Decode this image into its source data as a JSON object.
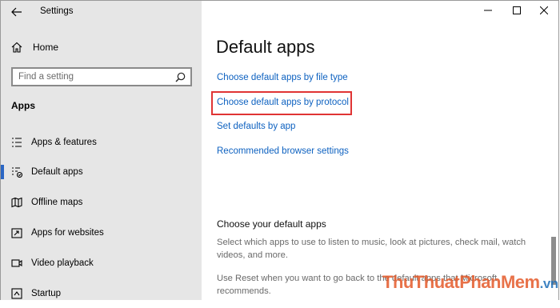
{
  "window": {
    "title": "Settings"
  },
  "sidebar": {
    "home_label": "Home",
    "search_placeholder": "Find a setting",
    "section_title": "Apps",
    "items": [
      {
        "label": "Apps & features",
        "icon": "list-icon",
        "selected": false
      },
      {
        "label": "Default apps",
        "icon": "default-apps-icon",
        "selected": true
      },
      {
        "label": "Offline maps",
        "icon": "map-icon",
        "selected": false
      },
      {
        "label": "Apps for websites",
        "icon": "open-in-window-icon",
        "selected": false
      },
      {
        "label": "Video playback",
        "icon": "video-icon",
        "selected": false
      },
      {
        "label": "Startup",
        "icon": "startup-icon",
        "selected": false
      }
    ]
  },
  "main": {
    "title": "Default apps",
    "links": [
      {
        "label": "Choose default apps by file type",
        "highlighted": false
      },
      {
        "label": "Choose default apps by protocol",
        "highlighted": true
      },
      {
        "label": "Set defaults by app",
        "highlighted": false
      },
      {
        "label": "Recommended browser settings",
        "highlighted": false
      }
    ],
    "section_title": "Choose your default apps",
    "paragraph1": "Select which apps to use to listen to music, look at pictures, check mail, watch videos, and more.",
    "paragraph2": "Use Reset when you want to go back to the default apps that Microsoft recommends."
  },
  "watermark": {
    "text": "ThuThuatPhanMem",
    "domain": ".vn"
  },
  "colors": {
    "link": "#0d61c0",
    "highlight_border": "#e03434",
    "selection_bar": "#2b66c4",
    "sidebar_bg": "#e6e6e6"
  }
}
